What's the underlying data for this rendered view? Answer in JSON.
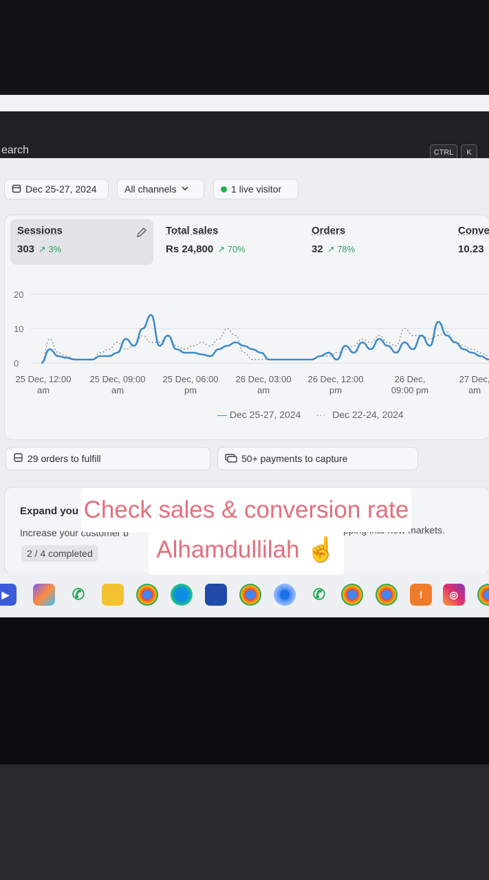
{
  "search": {
    "placeholder": "earch",
    "shortcut_ctrl": "CTRL",
    "shortcut_k": "K"
  },
  "filters": {
    "date_range": "Dec 25-27, 2024",
    "channels": "All channels",
    "live_visitors": "1 live visitor"
  },
  "metrics": [
    {
      "title": "Sessions",
      "value": "303",
      "delta": "3%"
    },
    {
      "title": "Total sales",
      "value": "Rs 24,800",
      "delta": "70%"
    },
    {
      "title": "Orders",
      "value": "32",
      "delta": "78%"
    },
    {
      "title": "Conve",
      "value": "10.23"
    }
  ],
  "chart_data": {
    "type": "line",
    "y_ticks": [
      "20",
      "10",
      "0"
    ],
    "x_ticks": [
      [
        "25 Dec, 12:00",
        "am"
      ],
      [
        "25 Dec, 09:00",
        "am"
      ],
      [
        "25 Dec, 06:00",
        "pm"
      ],
      [
        "26 Dec, 03:00",
        "am"
      ],
      [
        "26 Dec, 12:00",
        "pm"
      ],
      [
        "26 Dec,",
        "09:00 pm"
      ],
      [
        "27 Dec,",
        "am"
      ]
    ],
    "ylim": [
      0,
      20
    ],
    "grid": true,
    "legend_position": "bottom",
    "series": [
      {
        "name": "Dec 25-27, 2024",
        "style": "solid",
        "color": "#3e8bc9",
        "values": [
          0,
          4,
          2,
          1.5,
          1,
          1,
          1,
          2,
          2,
          3,
          7,
          5,
          10,
          14,
          5,
          8,
          4,
          3,
          3,
          2.5,
          2,
          4,
          5,
          6,
          5,
          4,
          3,
          1,
          1,
          1,
          1,
          1,
          1,
          2,
          3,
          1,
          5,
          3,
          6,
          4,
          7,
          5,
          3,
          6,
          4,
          8,
          5,
          12,
          8,
          6,
          4,
          3,
          2,
          1
        ]
      },
      {
        "name": "Dec 22-24, 2024",
        "style": "dotted",
        "color": "#8a8d92",
        "values": [
          0,
          7,
          3,
          2,
          1,
          1,
          1,
          3,
          4,
          6,
          4,
          5,
          8,
          6,
          6,
          8,
          5,
          4,
          5,
          6,
          5,
          7,
          10,
          8,
          3,
          1,
          1,
          1,
          1,
          1,
          1,
          1,
          1,
          2,
          2,
          3,
          4,
          5,
          7,
          6,
          8,
          6,
          5,
          10,
          8,
          8,
          7,
          8,
          9,
          6,
          5,
          4,
          3,
          2
        ]
      }
    ]
  },
  "tasks": {
    "fulfill": "29 orders to fulfill",
    "payments": "50+ payments to capture"
  },
  "setup": {
    "title": "Expand you",
    "description": "Increase your customer b",
    "description_tail": "pping into new markets.",
    "progress": "2 / 4 completed",
    "progress_fraction": 0.5
  },
  "overlay": {
    "line1": "Check sales & conversion rate",
    "line2": "Alhamdullilah ☝️"
  },
  "icons": [
    "edit-pencil-icon",
    "calendar-icon",
    "chevron-down-icon",
    "orders-box-icon",
    "payments-icon"
  ],
  "colors": {
    "accent": "#3e8bc9",
    "delta_positive": "#2f9e63",
    "live_dot": "#20b155",
    "overlay_text": "#e36f7c"
  }
}
